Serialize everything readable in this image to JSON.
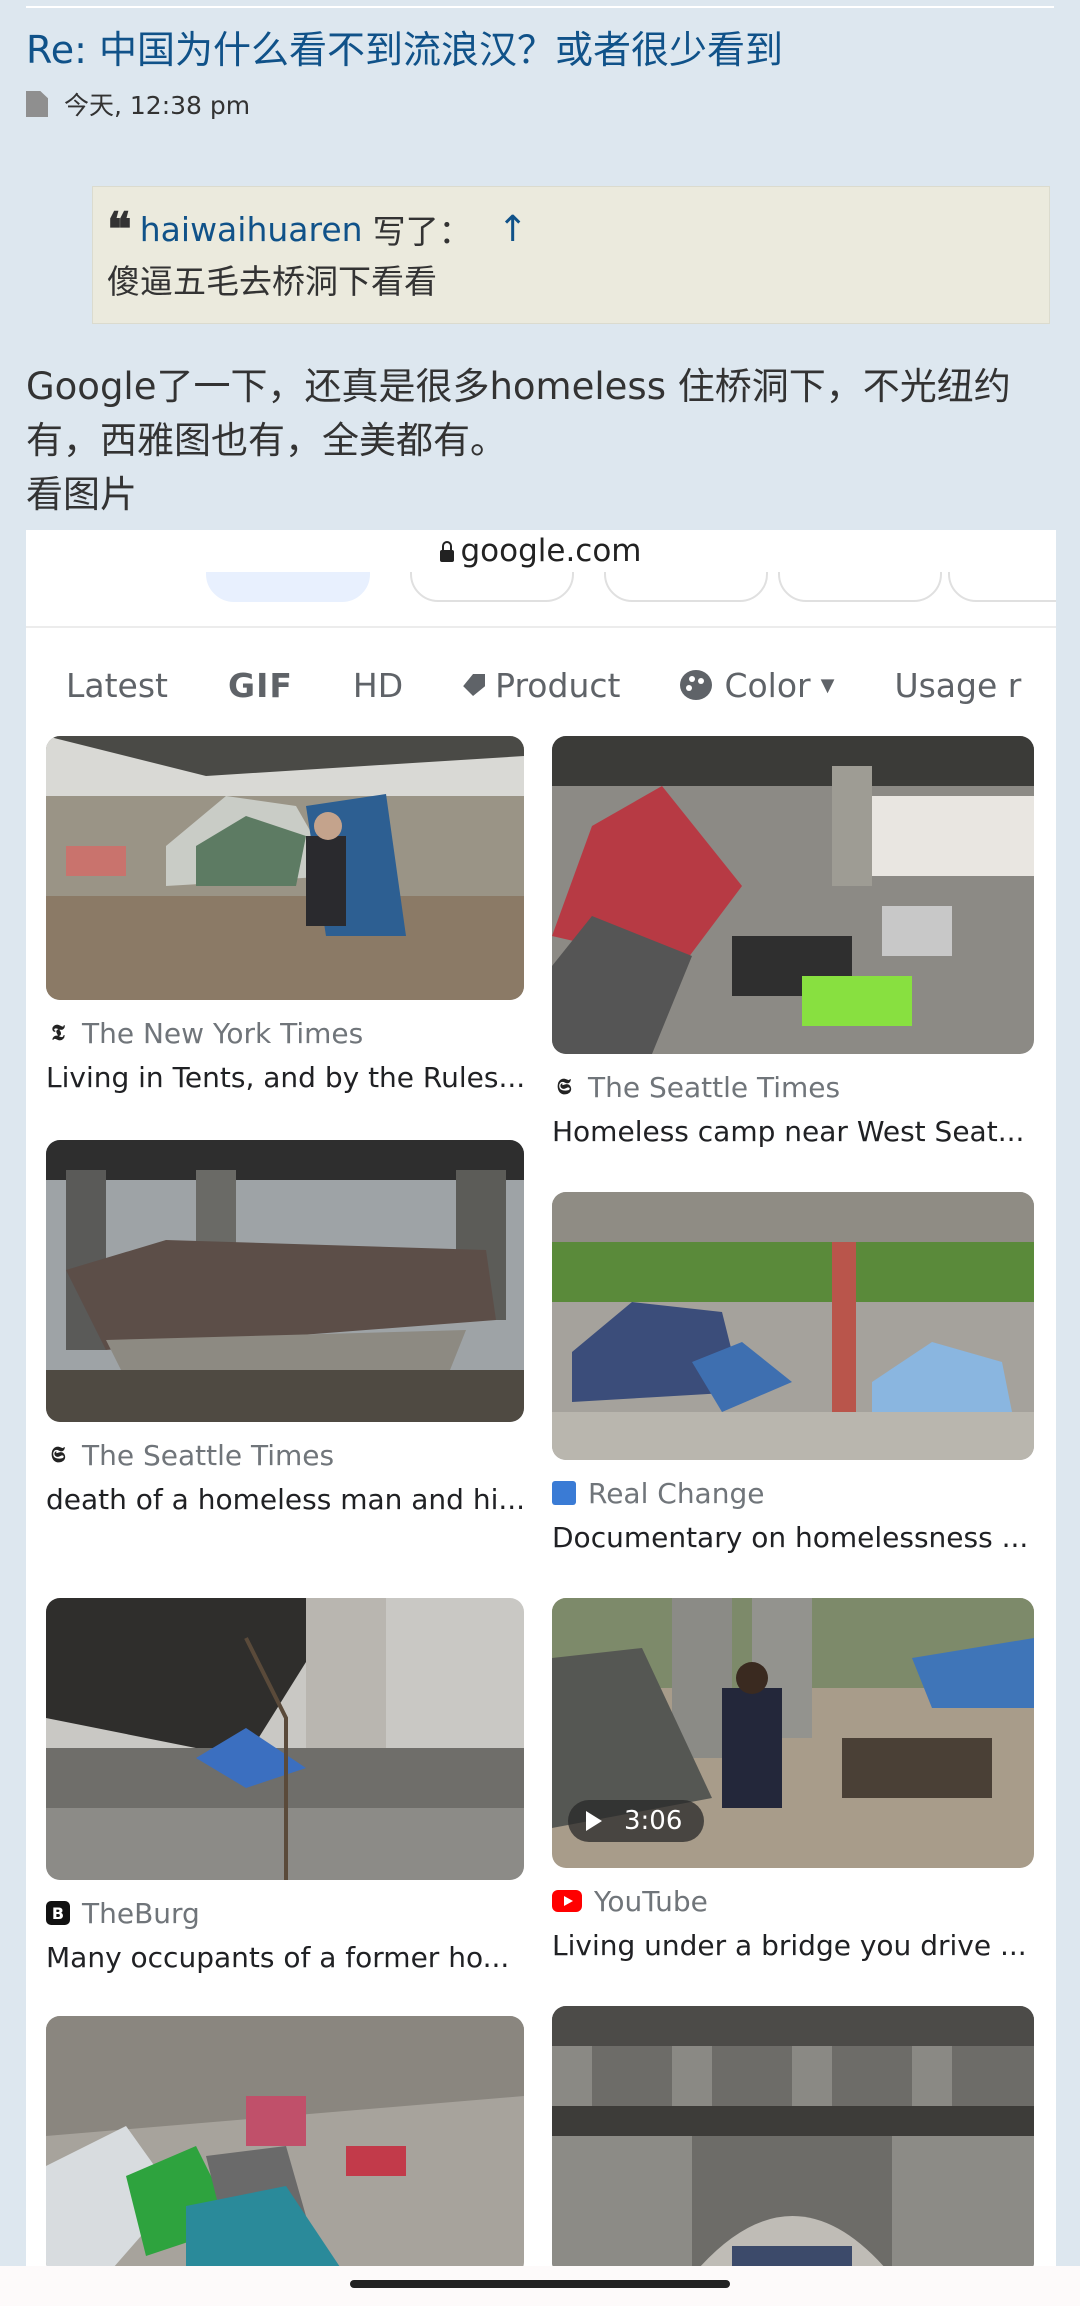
{
  "post": {
    "title": "Re: 中国为什么看不到流浪汉？或者很少看到",
    "time": "今天, 12:38 pm"
  },
  "quote": {
    "author": "haiwaihuaren",
    "wrote": "写了：",
    "arrow": "↑",
    "text": "傻逼五毛去桥洞下看看"
  },
  "content": {
    "line1": "Google了一下，还真是很多homeless 住桥洞下，不光纽约",
    "line2": "有，西雅图也有，全美都有。",
    "line3": "看图片"
  },
  "screenshot": {
    "url": "google.com",
    "filters": {
      "latest": "Latest",
      "gif": "GIF",
      "hd": "HD",
      "product": "Product",
      "color": "Color",
      "usage": "Usage r"
    },
    "results": [
      {
        "source": "The New York Times",
        "caption": "Living in Tents, and by the Rules...",
        "icon": "nyt-logo-icon"
      },
      {
        "source": "The Seattle Times",
        "caption": "Homeless camp near West Seat...",
        "icon": "seattle-times-logo-icon"
      },
      {
        "source": "The Seattle Times",
        "caption": "death of a homeless man and hi...",
        "icon": "seattle-times-logo-icon"
      },
      {
        "source": "Real Change",
        "caption": "Documentary on homelessness ...",
        "icon": "real-change-logo-icon"
      },
      {
        "source": "TheBurg",
        "caption": "Many occupants of a former ho...",
        "icon": "theburg-logo-icon"
      },
      {
        "source": "YouTube",
        "caption": "Living under a bridge you drive ...",
        "icon": "youtube-logo-icon",
        "duration": "3:06"
      },
      {
        "source": "",
        "caption": "",
        "icon": ""
      },
      {
        "source": "",
        "caption": "",
        "icon": ""
      }
    ]
  },
  "colors": {
    "page_bg": "#dde7ef",
    "link": "#105289",
    "quote_bg": "#ebeadd"
  }
}
